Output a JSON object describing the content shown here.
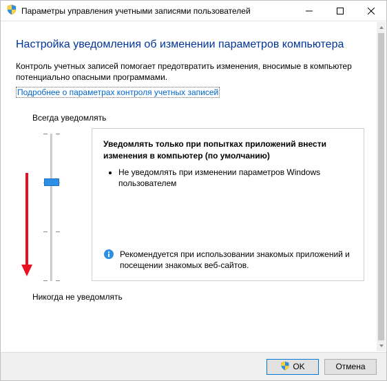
{
  "window": {
    "title": "Параметры управления учетными записями пользователей"
  },
  "page": {
    "heading": "Настройка уведомления об изменении параметров компьютера",
    "intro": "Контроль учетных записей помогает предотвратить изменения, вносимые в компьютер потенциально опасными программами.",
    "help_link": "Подробнее о параметрах контроля учетных записей"
  },
  "slider": {
    "top_label": "Всегда уведомлять",
    "bottom_label": "Никогда не уведомлять"
  },
  "description": {
    "title": "Уведомлять только при попытках приложений внести изменения в компьютер (по умолчанию)",
    "bullet1": "Не уведомлять при изменении параметров Windows пользователем",
    "recommendation": "Рекомендуется при использовании знакомых приложений и посещении знакомых веб-сайтов."
  },
  "buttons": {
    "ok": "OK",
    "cancel": "Отмена"
  }
}
